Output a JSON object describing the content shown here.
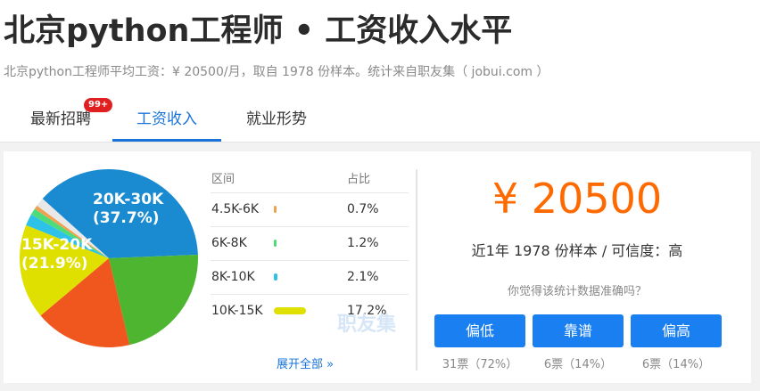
{
  "header": {
    "title": "北京python工程师 • 工资收入水平",
    "subtitle": "北京python工程师平均工资：¥ 20500/月，取自 1978 份样本。统计来自职友集（ jobui.com ）"
  },
  "tabs": [
    {
      "label": "最新招聘",
      "badge": "99+"
    },
    {
      "label": "工资收入",
      "active": true
    },
    {
      "label": "就业形势"
    }
  ],
  "chart_data": {
    "type": "pie",
    "slices": [
      {
        "label": "20K-30K",
        "value": 37.7,
        "color": "#1a8bd0"
      },
      {
        "label": "15K-20K",
        "value": 21.9,
        "color": "#4db52f"
      },
      {
        "label": "",
        "value": 17.6,
        "color": "#f0571f"
      },
      {
        "label": "10K-15K",
        "value": 17.2,
        "color": "#dfe000"
      },
      {
        "label": "8K-10K",
        "value": 2.1,
        "color": "#2ec2e8"
      },
      {
        "label": "6K-8K",
        "value": 1.2,
        "color": "#4ddc79"
      },
      {
        "label": "4.5K-6K",
        "value": 0.7,
        "color": "#f0a050"
      },
      {
        "label": "",
        "value": 1.6,
        "color": "#e8e8e8"
      }
    ],
    "label_text": [
      {
        "name": "20K-30K",
        "pct": "(37.7%)"
      },
      {
        "name": "15K-20K",
        "pct": "(21.9%)"
      }
    ]
  },
  "table": {
    "headers": {
      "range": "区间",
      "ratio": "占比"
    },
    "rows": [
      {
        "range": "4.5K-6K",
        "pct": "0.7%",
        "value": 0.7,
        "color": "#f0a050"
      },
      {
        "range": "6K-8K",
        "pct": "1.2%",
        "value": 1.2,
        "color": "#4ddc79"
      },
      {
        "range": "8K-10K",
        "pct": "2.1%",
        "value": 2.1,
        "color": "#2ec2e8"
      },
      {
        "range": "10K-15K",
        "pct": "17.2%",
        "value": 17.2,
        "color": "#dfe000"
      }
    ],
    "expand_label": "展开全部 »",
    "watermark": "职友集"
  },
  "summary": {
    "salary": "¥ 20500",
    "sample": "近1年 1978 份样本 / 可信度：高",
    "question": "你觉得该统计数据准确吗？"
  },
  "votes": [
    {
      "label": "偏低",
      "count": "31票（72%）"
    },
    {
      "label": "靠谱",
      "count": "6票（14%）"
    },
    {
      "label": "偏高",
      "count": "6票（14%）"
    }
  ]
}
